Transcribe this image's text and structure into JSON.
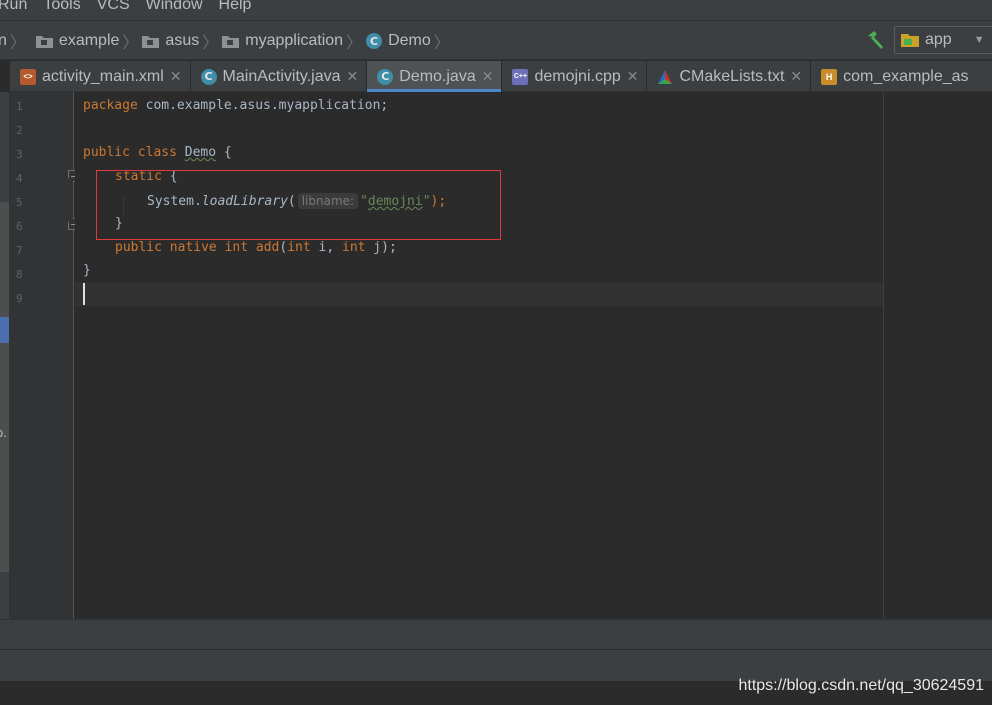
{
  "menu": {
    "items": [
      "Run",
      "Tools",
      "VCS",
      "Window",
      "Help"
    ]
  },
  "breadcrumb": {
    "items": [
      "n",
      "example",
      "asus",
      "myapplication",
      "Demo"
    ]
  },
  "run_config": {
    "label": "app"
  },
  "tabs": [
    {
      "label": "activity_main.xml",
      "icon": "xml-file-icon"
    },
    {
      "label": "MainActivity.java",
      "icon": "java-class-icon"
    },
    {
      "label": "Demo.java",
      "icon": "java-class-icon",
      "active": true
    },
    {
      "label": "demojni.cpp",
      "icon": "cpp-file-icon"
    },
    {
      "label": "CMakeLists.txt",
      "icon": "cmake-icon"
    },
    {
      "label": "com_example_as",
      "icon": "header-file-icon"
    }
  ],
  "editor": {
    "line_numbers": [
      "1",
      "2",
      "3",
      "4",
      "5",
      "6",
      "7",
      "8",
      "9"
    ],
    "code": {
      "l1_kw": "package",
      "l1_rest": " com.example.asus.myapplication;",
      "l3_kw": "public class",
      "l3_cls": "Demo",
      "l3_rest": " {",
      "l4_kw": "static",
      "l4_rest": " {",
      "l5_obj": "System.",
      "l5_method": "loadLibrary",
      "l5_open": "(",
      "l5_hint": "libname:",
      "l5_q1": "\"",
      "l5_str": "demojni",
      "l5_q2": "\"",
      "l5_close": ");",
      "l6_brace": "}",
      "l7_kw": "public native int",
      "l7_fn": "add",
      "l7_p1": "(",
      "l7_kw2": "int",
      "l7_p2": " i, ",
      "l7_kw3": "int",
      "l7_p3": " j);",
      "l8_brace": "}"
    }
  },
  "left_strip": {
    "text": "o."
  },
  "watermark": "https://blog.csdn.net/qq_30624591",
  "colors": {
    "keyword": "#cc7832",
    "string": "#6a8759",
    "function": "#ffc66d",
    "plain": "#a9b7c6",
    "highlight_box": "#e03a3a",
    "active_tab_underline": "#4a88c7"
  }
}
